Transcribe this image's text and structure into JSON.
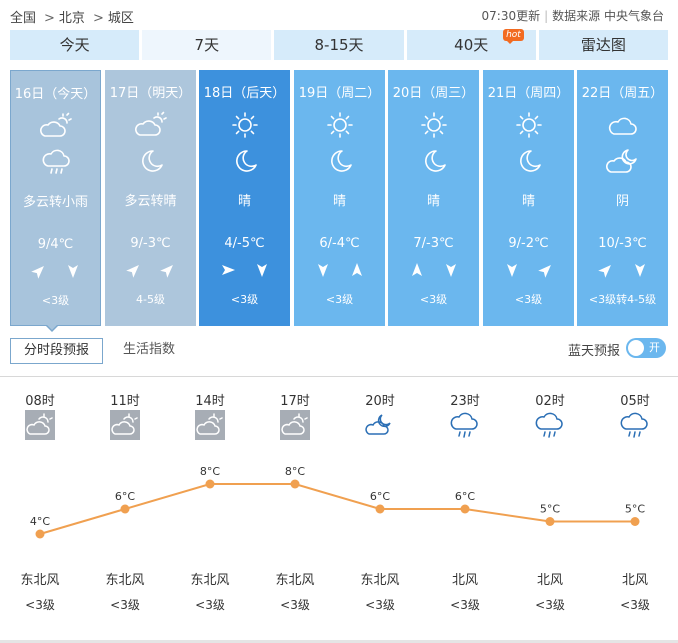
{
  "breadcrumb": [
    "全国",
    "北京",
    "城区"
  ],
  "breadcrumb_sep": ">",
  "update_time": "07:30更新",
  "data_source": "数据来源 中央气象台",
  "tabs": [
    {
      "label": "今天"
    },
    {
      "label": "7天"
    },
    {
      "label": "8-15天"
    },
    {
      "label": "40天",
      "badge": "hot"
    },
    {
      "label": "雷达图"
    }
  ],
  "days": [
    {
      "date": "16日（今天）",
      "icon1": "partly-cloudy-day-icon",
      "icon2": "light-rain-icon",
      "desc": "多云转小雨",
      "temp": "9/4℃",
      "wind1": "northeast-arrow-icon",
      "wind2": "south-arrow-icon",
      "level": "<3级"
    },
    {
      "date": "17日（明天）",
      "icon1": "partly-cloudy-day-icon",
      "icon2": "moon-icon",
      "desc": "多云转晴",
      "temp": "9/-3℃",
      "wind1": "northeast-arrow-icon",
      "wind2": "northeast-arrow-icon",
      "level": "4-5级"
    },
    {
      "date": "18日（后天）",
      "icon1": "sun-icon",
      "icon2": "moon-icon",
      "desc": "晴",
      "temp": "4/-5℃",
      "wind1": "east-arrow-icon",
      "wind2": "south-arrow-icon",
      "level": "<3级"
    },
    {
      "date": "19日（周二）",
      "icon1": "sun-icon",
      "icon2": "moon-icon",
      "desc": "晴",
      "temp": "6/-4℃",
      "wind1": "south-arrow-icon",
      "wind2": "north-arrow-icon",
      "level": "<3级"
    },
    {
      "date": "20日（周三）",
      "icon1": "sun-icon",
      "icon2": "moon-icon",
      "desc": "晴",
      "temp": "7/-3℃",
      "wind1": "north-arrow-icon",
      "wind2": "south-arrow-icon",
      "level": "<3级"
    },
    {
      "date": "21日（周四）",
      "icon1": "sun-icon",
      "icon2": "moon-icon",
      "desc": "晴",
      "temp": "9/-2℃",
      "wind1": "south-arrow-icon",
      "wind2": "northeast-arrow-icon",
      "level": "<3级"
    },
    {
      "date": "22日（周五）",
      "icon1": "cloudy-icon",
      "icon2": "partly-cloudy-night-icon",
      "desc": "阴",
      "temp": "10/-3℃",
      "wind1": "northeast-arrow-icon",
      "wind2": "south-arrow-icon",
      "level": "<3级转4-5级"
    }
  ],
  "subtabs": {
    "active": "分时段预报",
    "other": "生活指数"
  },
  "blue_sky_label": "蓝天预报",
  "toggle_label": "开",
  "hourly": [
    {
      "time": "08时",
      "icon": "partly-cloudy-icon",
      "temp": "4°C",
      "wind": "东北风",
      "level": "<3级"
    },
    {
      "time": "11时",
      "icon": "partly-cloudy-icon",
      "temp": "6°C",
      "wind": "东北风",
      "level": "<3级"
    },
    {
      "time": "14时",
      "icon": "partly-cloudy-icon",
      "temp": "8°C",
      "wind": "东北风",
      "level": "<3级"
    },
    {
      "time": "17时",
      "icon": "partly-cloudy-icon",
      "temp": "8°C",
      "wind": "东北风",
      "level": "<3级"
    },
    {
      "time": "20时",
      "icon": "cloudy-night-icon",
      "temp": "6°C",
      "wind": "东北风",
      "level": "<3级"
    },
    {
      "time": "23时",
      "icon": "rain-icon",
      "temp": "6°C",
      "wind": "北风",
      "level": "<3级"
    },
    {
      "time": "02时",
      "icon": "rain-icon",
      "temp": "5°C",
      "wind": "北风",
      "level": "<3级"
    },
    {
      "time": "05时",
      "icon": "rain-icon",
      "temp": "5°C",
      "wind": "北风",
      "level": "<3级"
    }
  ],
  "chart_data": {
    "type": "line",
    "x": [
      "08时",
      "11时",
      "14时",
      "17时",
      "20时",
      "23时",
      "02时",
      "05时"
    ],
    "series": [
      {
        "values": [
          4,
          6,
          8,
          8,
          6,
          6,
          5,
          5
        ]
      }
    ],
    "unit": "°C"
  },
  "colors": {
    "line": "#f0a050",
    "today": "#a8c4dc",
    "selected": "#3d91dd",
    "day": "#6bb7ee"
  }
}
